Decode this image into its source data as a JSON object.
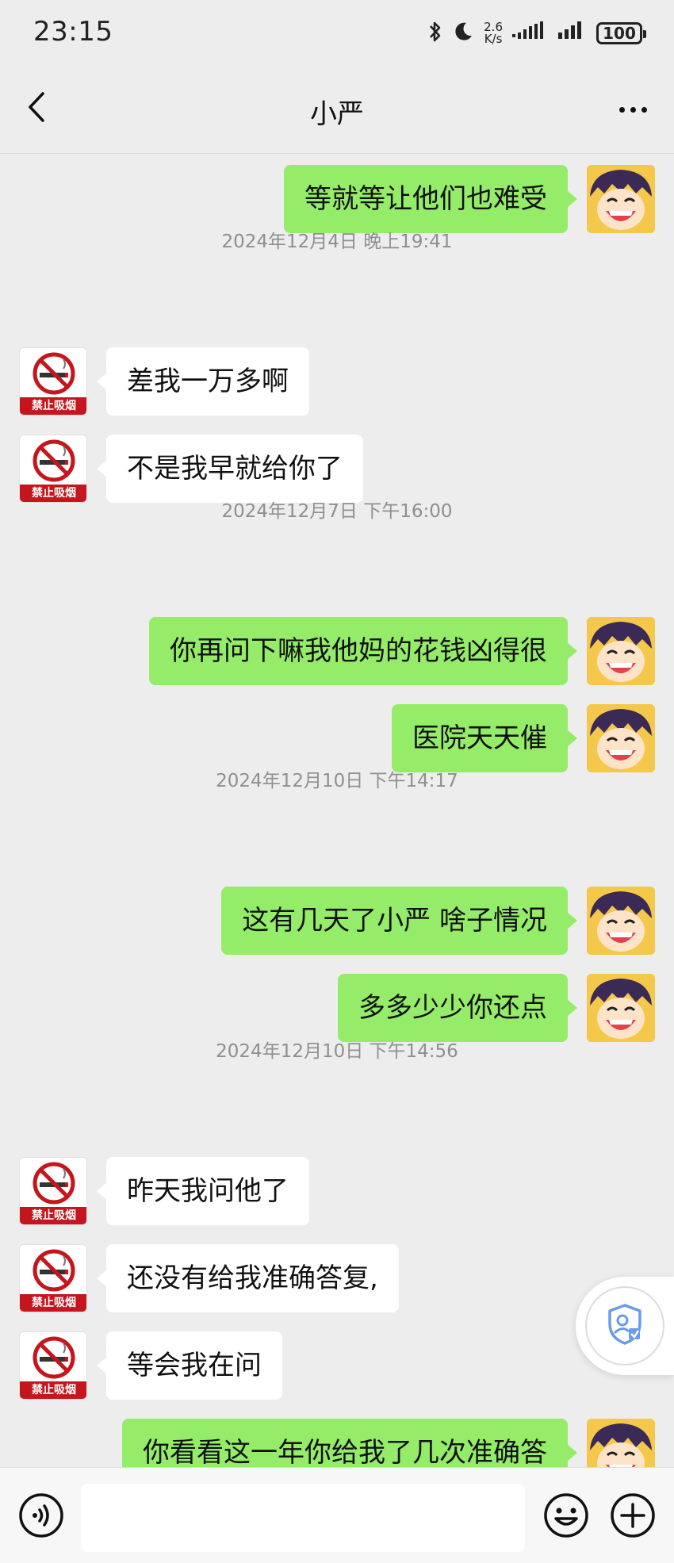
{
  "status_bar": {
    "time": "23:15",
    "network_speed_value": "2.6",
    "network_speed_unit": "K/s",
    "battery": "100",
    "icons": [
      "bluetooth-icon",
      "moon-icon",
      "signal-icon",
      "signal-icon"
    ]
  },
  "header": {
    "title": "小严",
    "back_icon": "chevron-left-icon",
    "more_icon": "more-dots-icon"
  },
  "timestamps": [
    "2024年12月4日 晚上19:41",
    "2024年12月7日 下午16:00",
    "2024年12月10日 下午14:17",
    "2024年12月10日 下午14:56"
  ],
  "messages": [
    {
      "side": "right",
      "text": "等就等让他们也难受"
    },
    {
      "side": "left",
      "text": "差我一万多啊"
    },
    {
      "side": "left",
      "text": "不是我早就给你了"
    },
    {
      "side": "right",
      "text": "你再问下嘛我他妈的花钱凶得很"
    },
    {
      "side": "right",
      "text": "医院天天催"
    },
    {
      "side": "right",
      "text": "这有几天了小严 啥子情况"
    },
    {
      "side": "right",
      "text": "多多少少你还点"
    },
    {
      "side": "left",
      "text": "昨天我问他了"
    },
    {
      "side": "left",
      "text": "还没有给我准确答复,"
    },
    {
      "side": "left",
      "text": "等会我在问"
    },
    {
      "side": "right",
      "text": "你看看这一年你给我了几次准确答"
    }
  ],
  "avatars": {
    "left_sign_text": "禁止吸烟",
    "left_icon": "no-smoking-icon",
    "right_icon": "cartoon-avatar-icon"
  },
  "floating": {
    "icon": "shield-user-icon"
  },
  "input_bar": {
    "voice_icon": "voice-icon",
    "emoji_icon": "emoji-icon",
    "plus_icon": "plus-circle-icon",
    "input_value": ""
  },
  "colors": {
    "background": "#ededed",
    "bubble_self": "#95ec69",
    "bubble_other": "#ffffff",
    "no_smoking_red": "#c5161d"
  }
}
